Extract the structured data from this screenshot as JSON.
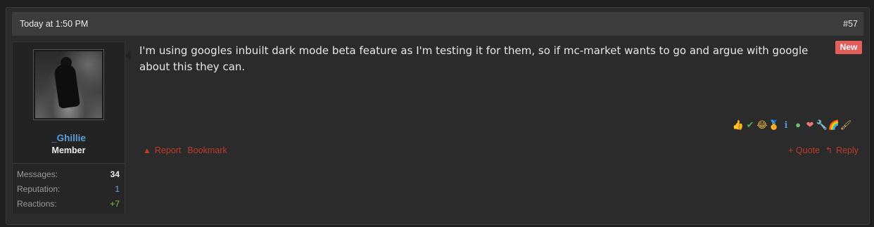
{
  "post": {
    "date": "Today at 1:50 PM",
    "number": "#57",
    "badge": "New",
    "message": "I'm using googles inbuilt dark mode beta feature as I'm testing it for them, so if mc-market wants to go and argue with google about this they can."
  },
  "user": {
    "name": "_Ghillie",
    "title": "Member",
    "stats": [
      {
        "label": "Messages:",
        "value": "34"
      },
      {
        "label": "Reputation:",
        "value": "1"
      },
      {
        "label": "Reactions:",
        "value": "+7"
      }
    ]
  },
  "reactions": [
    {
      "icon": "thumbs-up-icon",
      "glyph": "👍",
      "color": "#c98a5a"
    },
    {
      "icon": "check-icon",
      "glyph": "✔",
      "color": "#4caf50"
    },
    {
      "icon": "laugh-icon",
      "glyph": "😂",
      "color": "#e2b33a"
    },
    {
      "icon": "medal-icon",
      "glyph": "🏅",
      "color": "#d4a13a"
    },
    {
      "icon": "info-icon",
      "glyph": "ℹ",
      "color": "#5b8fd8"
    },
    {
      "icon": "agree-icon",
      "glyph": "●",
      "color": "#6fbf73"
    },
    {
      "icon": "heart-icon",
      "glyph": "❤",
      "color": "#e97878"
    },
    {
      "icon": "wrench-icon",
      "glyph": "🔧",
      "color": "#b0b0b0"
    },
    {
      "icon": "rainbow-icon",
      "glyph": "🌈",
      "color": "#e36a5e"
    },
    {
      "icon": "brush-icon",
      "glyph": "🖌",
      "color": "#d8b46a"
    }
  ],
  "actions": {
    "report": "Report",
    "bookmark": "Bookmark",
    "quote": "+ Quote",
    "reply": "Reply"
  }
}
